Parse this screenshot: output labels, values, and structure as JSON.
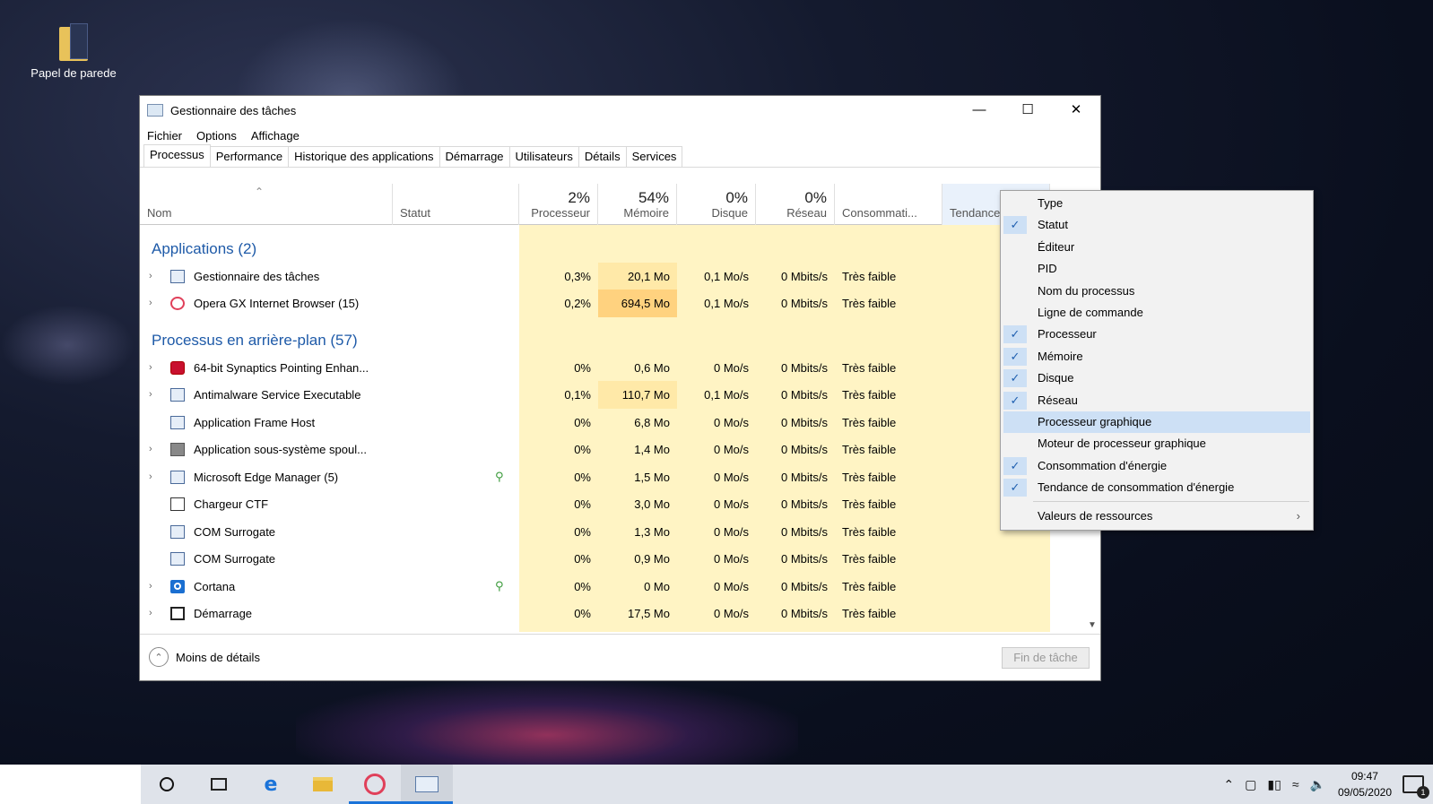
{
  "desktop": {
    "icon_label": "Papel de parede"
  },
  "window": {
    "title": "Gestionnaire des tâches",
    "menu": [
      "Fichier",
      "Options",
      "Affichage"
    ],
    "tabs": [
      "Processus",
      "Performance",
      "Historique des applications",
      "Démarrage",
      "Utilisateurs",
      "Détails",
      "Services"
    ],
    "active_tab": "Processus",
    "columns": {
      "name": "Nom",
      "status": "Statut",
      "cpu": {
        "pct": "2%",
        "label": "Processeur"
      },
      "memory": {
        "pct": "54%",
        "label": "Mémoire"
      },
      "disk": {
        "pct": "0%",
        "label": "Disque"
      },
      "network": {
        "pct": "0%",
        "label": "Réseau"
      },
      "power": "Consommati...",
      "trend": "Tendance"
    },
    "groups": {
      "apps": "Applications (2)",
      "background": "Processus en arrière-plan (57)"
    },
    "rows": [
      {
        "name": "Gestionnaire des tâches",
        "cpu": "0,3%",
        "mem": "20,1 Mo",
        "disk": "0,1 Mo/s",
        "net": "0 Mbits/s",
        "power": "Très faible"
      },
      {
        "name": "Opera GX Internet Browser (15)",
        "cpu": "0,2%",
        "mem": "694,5 Mo",
        "disk": "0,1 Mo/s",
        "net": "0 Mbits/s",
        "power": "Très faible"
      },
      {
        "name": "64-bit Synaptics Pointing Enhan...",
        "cpu": "0%",
        "mem": "0,6 Mo",
        "disk": "0 Mo/s",
        "net": "0 Mbits/s",
        "power": "Très faible"
      },
      {
        "name": "Antimalware Service Executable",
        "cpu": "0,1%",
        "mem": "110,7 Mo",
        "disk": "0,1 Mo/s",
        "net": "0 Mbits/s",
        "power": "Très faible"
      },
      {
        "name": "Application Frame Host",
        "cpu": "0%",
        "mem": "6,8 Mo",
        "disk": "0 Mo/s",
        "net": "0 Mbits/s",
        "power": "Très faible"
      },
      {
        "name": "Application sous-système spoul...",
        "cpu": "0%",
        "mem": "1,4 Mo",
        "disk": "0 Mo/s",
        "net": "0 Mbits/s",
        "power": "Très faible"
      },
      {
        "name": "Microsoft Edge Manager (5)",
        "cpu": "0%",
        "mem": "1,5 Mo",
        "disk": "0 Mo/s",
        "net": "0 Mbits/s",
        "power": "Très faible"
      },
      {
        "name": "Chargeur CTF",
        "cpu": "0%",
        "mem": "3,0 Mo",
        "disk": "0 Mo/s",
        "net": "0 Mbits/s",
        "power": "Très faible"
      },
      {
        "name": "COM Surrogate",
        "cpu": "0%",
        "mem": "1,3 Mo",
        "disk": "0 Mo/s",
        "net": "0 Mbits/s",
        "power": "Très faible"
      },
      {
        "name": "COM Surrogate",
        "cpu": "0%",
        "mem": "0,9 Mo",
        "disk": "0 Mo/s",
        "net": "0 Mbits/s",
        "power": "Très faible"
      },
      {
        "name": "Cortana",
        "cpu": "0%",
        "mem": "0 Mo",
        "disk": "0 Mo/s",
        "net": "0 Mbits/s",
        "power": "Très faible"
      },
      {
        "name": "Démarrage",
        "cpu": "0%",
        "mem": "17,5 Mo",
        "disk": "0 Mo/s",
        "net": "0 Mbits/s",
        "power": "Très faible"
      }
    ],
    "footer": {
      "less_details": "Moins de détails",
      "end_task": "Fin de tâche"
    }
  },
  "context_menu": {
    "items": [
      {
        "label": "Type",
        "checked": false
      },
      {
        "label": "Statut",
        "checked": true
      },
      {
        "label": "Éditeur",
        "checked": false
      },
      {
        "label": "PID",
        "checked": false
      },
      {
        "label": "Nom du processus",
        "checked": false
      },
      {
        "label": "Ligne de commande",
        "checked": false
      },
      {
        "label": "Processeur",
        "checked": true
      },
      {
        "label": "Mémoire",
        "checked": true
      },
      {
        "label": "Disque",
        "checked": true
      },
      {
        "label": "Réseau",
        "checked": true
      },
      {
        "label": "Processeur graphique",
        "checked": false
      },
      {
        "label": "Moteur de processeur graphique",
        "checked": false
      },
      {
        "label": "Consommation d'énergie",
        "checked": true
      },
      {
        "label": "Tendance de consommation d'énergie",
        "checked": true
      }
    ],
    "highlighted": "Processeur graphique",
    "submenu": "Valeurs de ressources"
  },
  "taskbar": {
    "time": "09:47",
    "date": "09/05/2020",
    "notifications": "1"
  },
  "colors": {
    "heat_light": "#fff4c4",
    "heat_mid": "#ffe9a8",
    "heat_high": "#ffd27f",
    "group_blue": "#1e5aa8",
    "highlight": "#cde0f5"
  }
}
